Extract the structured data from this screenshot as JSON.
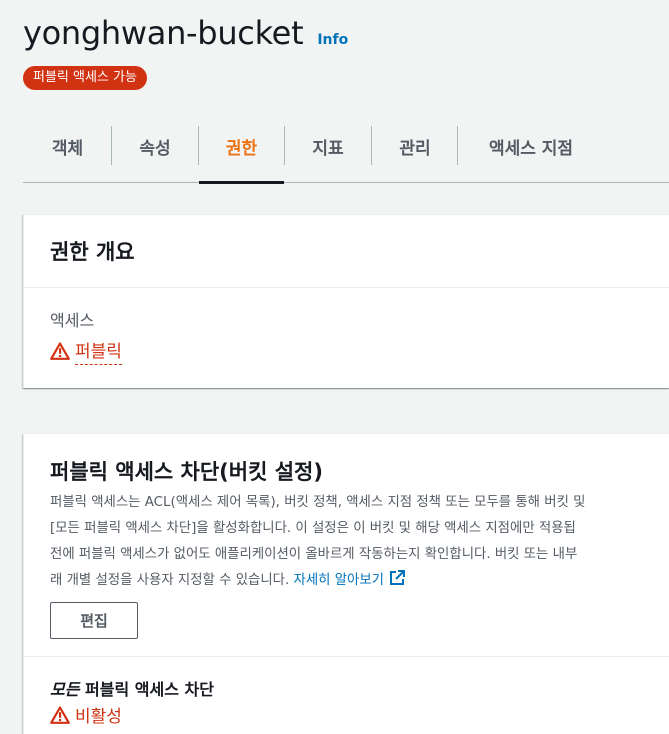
{
  "header": {
    "bucket_name": "yonghwan-bucket",
    "info_label": "Info",
    "badge_label": "퍼블릭 액세스 가능"
  },
  "tabs": [
    {
      "label": "객체",
      "active": false
    },
    {
      "label": "속성",
      "active": false
    },
    {
      "label": "권한",
      "active": true
    },
    {
      "label": "지표",
      "active": false
    },
    {
      "label": "관리",
      "active": false
    },
    {
      "label": "액세스 지점",
      "active": false
    }
  ],
  "overview": {
    "title": "권한 개요",
    "access_label": "액세스",
    "access_value": "퍼블릭"
  },
  "block_public_access": {
    "title": "퍼블릭 액세스 차단(버킷 설정)",
    "description_lines": [
      "퍼블릭 액세스는 ACL(액세스 제어 목록), 버킷 정책, 액세스 지점 정책 또는 모두를 통해 버킷 및",
      "[모든 퍼블릭 액세스 차단]을 활성화합니다. 이 설정은 이 버킷 및 해당 액세스 지점에만 적용됩",
      "전에 퍼블릭 액세스가 없어도 애플리케이션이 올바르게 작동하는지 확인합니다. 버킷 또는 내부",
      "래 개별 설정을 사용자 지정할 수 있습니다."
    ],
    "learn_more": "자세히 알아보기",
    "edit_button": "편집",
    "block_all_italic": "모든",
    "block_all_rest": " 퍼블릭 액세스 차단",
    "block_all_status": "비활성"
  },
  "colors": {
    "accent": "#ec7211",
    "danger": "#d13212",
    "link": "#0073bb"
  },
  "icons": [
    "warning-icon",
    "external-link-icon"
  ]
}
